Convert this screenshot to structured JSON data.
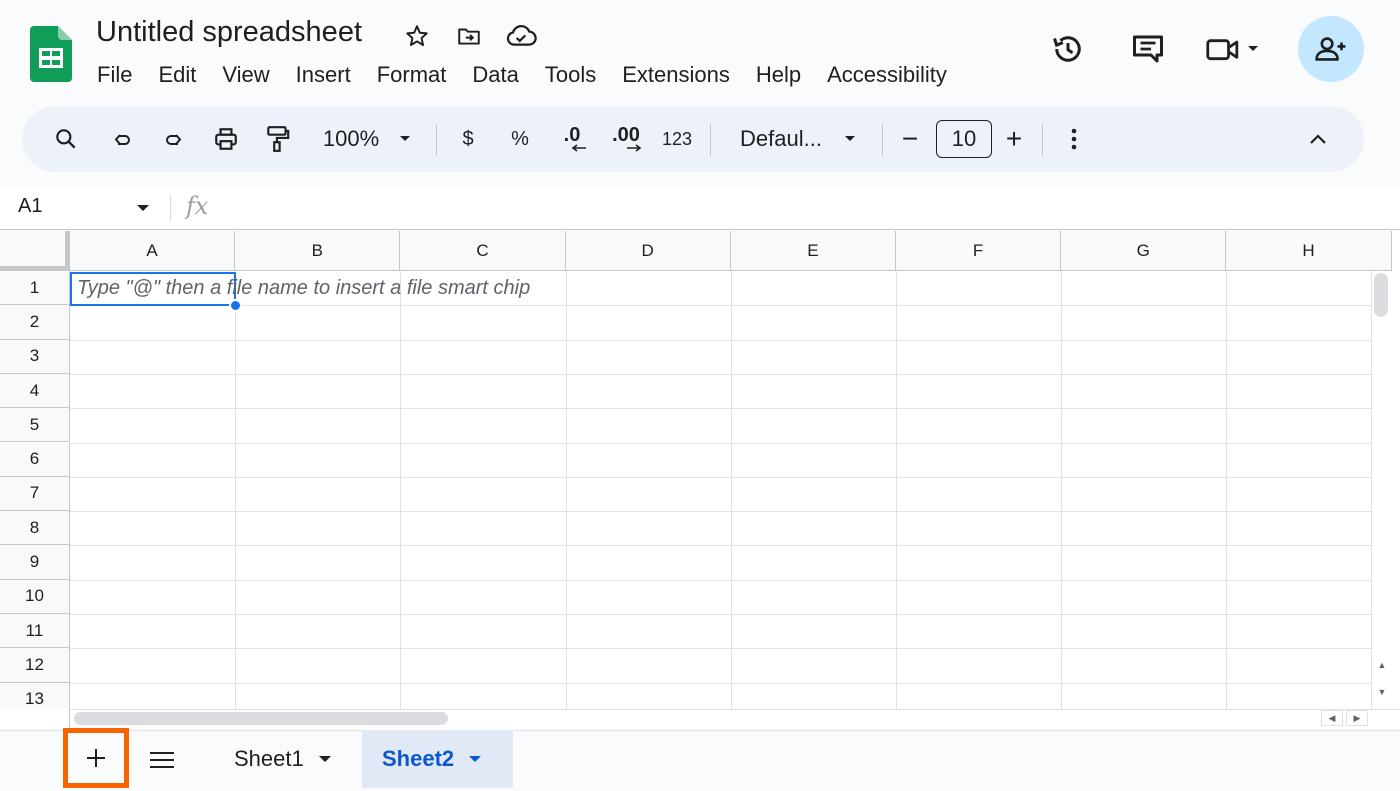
{
  "doc": {
    "title": "Untitled spreadsheet"
  },
  "menu": [
    "File",
    "Edit",
    "View",
    "Insert",
    "Format",
    "Data",
    "Tools",
    "Extensions",
    "Help",
    "Accessibility"
  ],
  "toolbar": {
    "zoom": "100%",
    "currency": "$",
    "percent": "%",
    "decrease_decimal": ".0",
    "increase_decimal": ".00",
    "number_format": "123",
    "font": "Defaul...",
    "font_size": "10",
    "minus": "−",
    "plus": "+"
  },
  "formula_bar": {
    "cell_ref": "A1",
    "fx": "fx"
  },
  "grid": {
    "columns": [
      "A",
      "B",
      "C",
      "D",
      "E",
      "F",
      "G",
      "H"
    ],
    "rows": [
      "1",
      "2",
      "3",
      "4",
      "5",
      "6",
      "7",
      "8",
      "9",
      "10",
      "11",
      "12",
      "13"
    ],
    "placeholder": "Type \"@\" then a file name to insert a file smart chip"
  },
  "sheets": [
    {
      "label": "Sheet1",
      "active": false
    },
    {
      "label": "Sheet2",
      "active": true
    }
  ],
  "colors": {
    "accent": "#0b57d0",
    "selection": "#1a73e8",
    "highlight": "#fa6400",
    "share_bg": "#c2e7ff",
    "sheets_green": "#0f9d58"
  }
}
